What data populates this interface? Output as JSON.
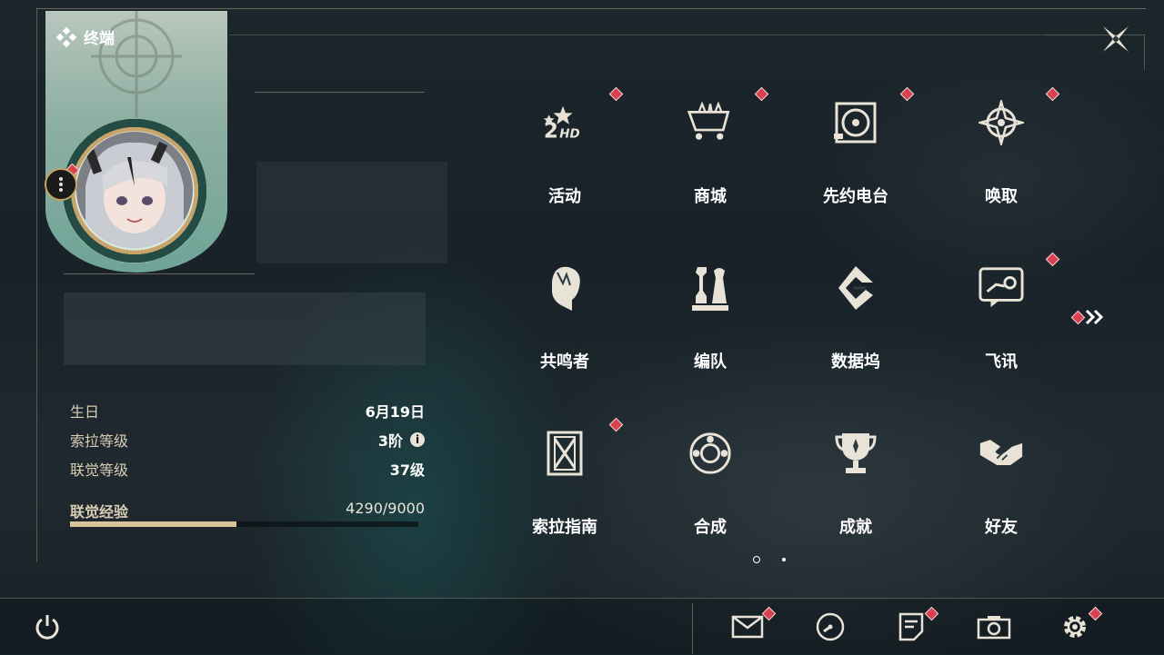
{
  "header": {
    "title": "终端",
    "close_icon": "close-x-icon"
  },
  "profile": {
    "menu_icon": "more-vertical-icon",
    "birthday_label": "生日",
    "birthday_value": "6月19日",
    "sola_level_label": "索拉等级",
    "sola_level_value": "3阶",
    "union_level_label": "联觉等级",
    "union_level_value": "37级",
    "exp_label": "联觉经验",
    "exp_value": "4290/9000",
    "exp_progress": 0.4767,
    "info_glyph": "i"
  },
  "grid": {
    "tiles": [
      {
        "label": "活动",
        "icon": "event-2hd-icon",
        "badge": true
      },
      {
        "label": "商城",
        "icon": "shop-cart-icon",
        "badge": true
      },
      {
        "label": "先约电台",
        "icon": "radio-record-icon",
        "badge": true
      },
      {
        "label": "唤取",
        "icon": "convene-compass-icon",
        "badge": true
      },
      {
        "label": "共鸣者",
        "icon": "resonator-head-icon",
        "badge": false
      },
      {
        "label": "编队",
        "icon": "team-chess-icon",
        "badge": false
      },
      {
        "label": "数据坞",
        "icon": "data-bank-icon",
        "badge": false
      },
      {
        "label": "飞讯",
        "icon": "message-chat-icon",
        "badge": true
      },
      {
        "label": "索拉指南",
        "icon": "guidebook-icon",
        "badge": true
      },
      {
        "label": "合成",
        "icon": "synthesis-orb-icon",
        "badge": false
      },
      {
        "label": "成就",
        "icon": "achievement-trophy-icon",
        "badge": false
      },
      {
        "label": "好友",
        "icon": "friends-handshake-icon",
        "badge": false
      }
    ],
    "next_page_icon": "double-chevron-right-icon",
    "page_count": 2,
    "current_page": 1
  },
  "bottom": {
    "power_icon": "power-icon",
    "mail_icon": "mail-icon",
    "clock_icon": "clock-icon",
    "notice_icon": "notice-icon",
    "camera_icon": "camera-icon",
    "settings_icon": "settings-gear-icon"
  },
  "colors": {
    "badge": "#d8414e",
    "accent_gold": "#c6a564",
    "exp_fill": "#d7c49a"
  }
}
